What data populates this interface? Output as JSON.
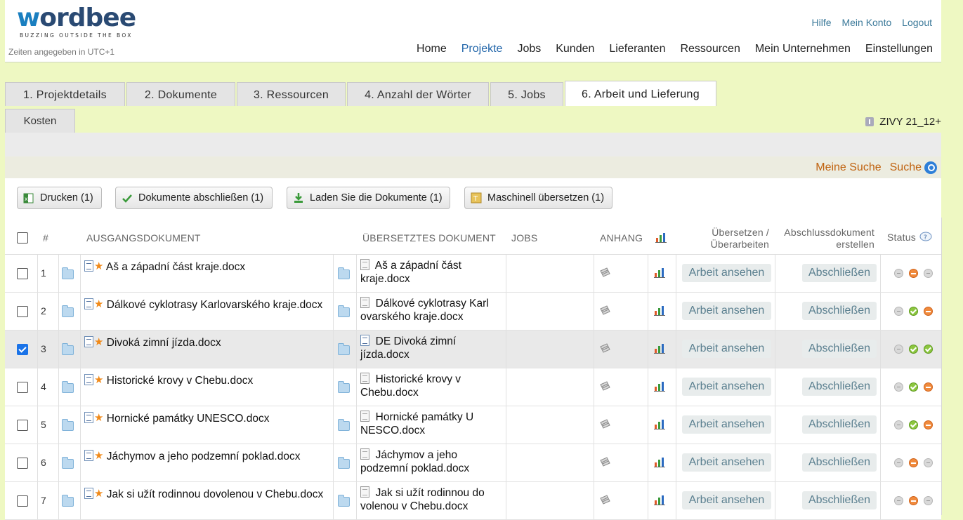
{
  "brand": {
    "logo_word_a": "w",
    "logo_word_b": "ordbee",
    "tagline": "BUZZING OUTSIDE THE BOX"
  },
  "timezone_note": "Zeiten angegeben in UTC+1",
  "top_links": {
    "help": "Hilfe",
    "account": "Mein Konto",
    "logout": "Logout"
  },
  "main_nav": [
    {
      "label": "Home",
      "active": false
    },
    {
      "label": "Projekte",
      "active": true
    },
    {
      "label": "Jobs",
      "active": false
    },
    {
      "label": "Kunden",
      "active": false
    },
    {
      "label": "Lieferanten",
      "active": false
    },
    {
      "label": "Ressourcen",
      "active": false
    },
    {
      "label": "Mein Unternehmen",
      "active": false
    },
    {
      "label": "Einstellungen",
      "active": false
    }
  ],
  "tabs": [
    {
      "label": "1. Projektdetails",
      "active": false
    },
    {
      "label": "2. Dokumente",
      "active": false
    },
    {
      "label": "3. Ressourcen",
      "active": false
    },
    {
      "label": "4. Anzahl der Wörter",
      "active": false
    },
    {
      "label": "5. Jobs",
      "active": false
    },
    {
      "label": "6. Arbeit und Lieferung",
      "active": true
    }
  ],
  "subtab": "Kosten",
  "project_code": "ZIVY 21_12+",
  "search": {
    "my_search": "Meine Suche",
    "search": "Suche"
  },
  "toolbar": {
    "print": "Drucken (1)",
    "close_docs": "Dokumente abschließen (1)",
    "download": "Laden Sie die Dokumente (1)",
    "machine_translate": "Maschinell übersetzen (1)"
  },
  "columns": {
    "num": "#",
    "source": "AUSGANGSDOKUMENT",
    "target": "ÜBERSETZTES DOKUMENT",
    "jobs": "JOBS",
    "attachment": "ANHANG",
    "translate_l1": "Übersetzen /",
    "translate_l2": "Überarbeiten",
    "final_l1": "Abschlussdokument",
    "final_l2": "erstellen",
    "status": "Status"
  },
  "actions": {
    "view_work": "Arbeit ansehen",
    "finalize": "Abschließen"
  },
  "rows": [
    {
      "num": "1",
      "checked": false,
      "source": "Aš a západní část kraje.docx",
      "target": "Aš a západní část kraje.docx",
      "target_prefix": "",
      "status": [
        "gray",
        "orange",
        "gray"
      ]
    },
    {
      "num": "2",
      "checked": false,
      "source": "Dálkové cyklotrasy Karlovarského kraje.docx",
      "target": "Dálkové cyklotrasy Karl ovarského kraje.docx",
      "target_prefix": "",
      "status": [
        "gray",
        "green",
        "orange"
      ]
    },
    {
      "num": "3",
      "checked": true,
      "source": "Divoká zimní jízda.docx",
      "target": "DE Divoká zimní jízda.docx",
      "target_prefix": "DE",
      "status": [
        "gray",
        "green",
        "green"
      ]
    },
    {
      "num": "4",
      "checked": false,
      "source": "Historické krovy v Chebu.docx",
      "target": "Historické krovy v Chebu.docx",
      "target_prefix": "",
      "status": [
        "gray",
        "green",
        "orange"
      ]
    },
    {
      "num": "5",
      "checked": false,
      "source": "Hornické památky UNESCO.docx",
      "target": "Hornické památky U NESCO.docx",
      "target_prefix": "",
      "status": [
        "gray",
        "green",
        "orange"
      ]
    },
    {
      "num": "6",
      "checked": false,
      "source": "Jáchymov a jeho podzemní poklad.docx",
      "target": "Jáchymov a jeho podzemní poklad.docx",
      "target_prefix": "",
      "status": [
        "gray",
        "orange",
        "gray"
      ]
    },
    {
      "num": "7",
      "checked": false,
      "source": "Jak si užít rodinnou dovolenou v Chebu.docx",
      "target": "Jak si užít rodinnou do volenou v Chebu.docx",
      "target_prefix": "",
      "status": [
        "gray",
        "orange",
        "gray"
      ]
    }
  ],
  "colors": {
    "page_bg": "#eef8c2",
    "link": "#3c7a9a",
    "search_link": "#c0620f",
    "active_nav": "#2266aa"
  }
}
